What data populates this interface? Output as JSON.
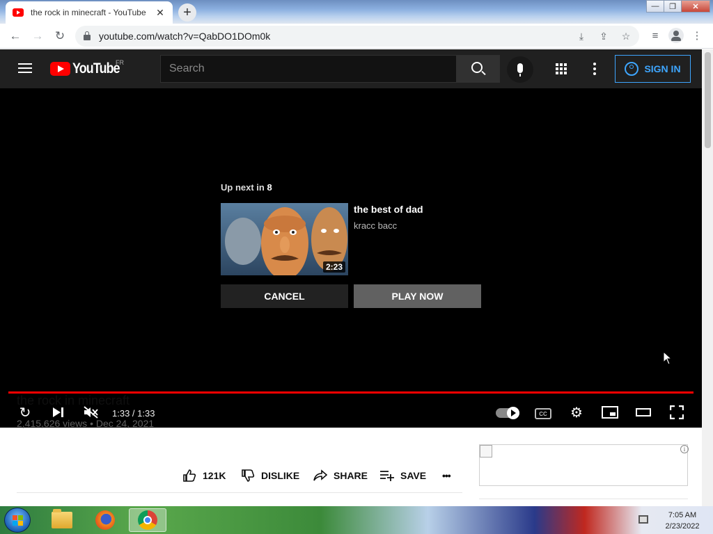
{
  "browser": {
    "tab_title": "the rock in minecraft - YouTube",
    "tab_close": "✕",
    "new_tab": "+",
    "url": "youtube.com/watch?v=QabDO1DOm0k",
    "window_controls": {
      "minimize": "—",
      "maximize": "❐",
      "close": "✕"
    }
  },
  "youtube": {
    "logo_text": "YouTube",
    "country_code": "FR",
    "search_placeholder": "Search",
    "sign_in": "SIGN IN"
  },
  "player": {
    "up_next_prefix": "Up next in",
    "up_next_seconds": "8",
    "next_video": {
      "title": "the best of dad",
      "channel": "kracc bacc",
      "duration": "2:23"
    },
    "cancel_label": "CANCEL",
    "play_now_label": "PLAY NOW",
    "time_display": "1:33 / 1:33",
    "progress_fraction": 1.0
  },
  "video": {
    "title": "the rock in minecraft",
    "meta": "2,415,626 views • Dec 24, 2021",
    "likes": "121K",
    "dislike_label": "DISLIKE",
    "share_label": "SHARE",
    "save_label": "SAVE",
    "more": "•••"
  },
  "ad": {
    "info": "i"
  },
  "taskbar": {
    "time": "7:05 AM",
    "date": "2/23/2022"
  },
  "colors": {
    "youtube_red": "#ff0000",
    "header_bg": "#202020",
    "signin_blue": "#3ea6ff",
    "player_bg": "#000000"
  }
}
